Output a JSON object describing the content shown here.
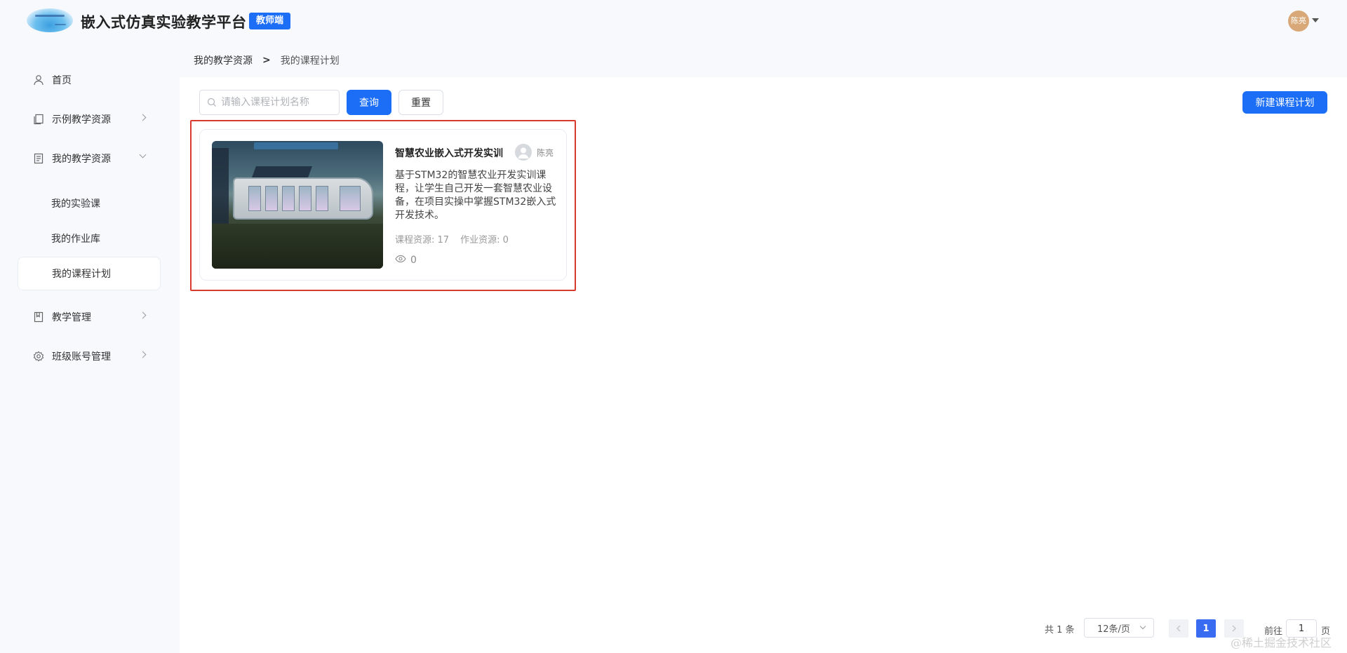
{
  "header": {
    "app_title": "嵌入式仿真实验教学平台",
    "role_badge": "教师端",
    "user_name": "陈亮"
  },
  "sidebar": {
    "items": [
      {
        "label": "首页",
        "icon": "user-icon"
      },
      {
        "label": "示例教学资源",
        "icon": "book-copy-icon"
      },
      {
        "label": "我的教学资源",
        "icon": "document-icon"
      },
      {
        "label": "教学管理",
        "icon": "bookmark-book-icon"
      },
      {
        "label": "班级账号管理",
        "icon": "gear-icon"
      }
    ],
    "sub_items": [
      {
        "label": "我的实验课"
      },
      {
        "label": "我的作业库"
      },
      {
        "label": "我的课程计划"
      }
    ]
  },
  "breadcrumb": {
    "parent": "我的教学资源",
    "separator": ">",
    "current": "我的课程计划"
  },
  "toolbar": {
    "search_placeholder": "请输入课程计划名称",
    "search_value": "",
    "query_label": "查询",
    "reset_label": "重置",
    "new_plan_label": "新建课程计划"
  },
  "cards": [
    {
      "title": "智慧农业嵌入式开发实训",
      "author": "陈亮",
      "description": "基于STM32的智慧农业开发实训课程，让学生自己开发一套智慧农业设备，在项目实操中掌握STM32嵌入式开发技术。",
      "course_resources": "课程资源: 17",
      "homework_resources": "作业资源: 0",
      "views": "0"
    }
  ],
  "pagination": {
    "total": "共 1 条",
    "page_size": "12条/页",
    "current_page": "1",
    "goto_label": "前往",
    "goto_value": "1",
    "page_suffix": "页"
  },
  "watermark": "@稀土掘金技术社区",
  "colors": {
    "primary": "#1b6ef5",
    "highlight": "#d93a2f",
    "page_active": "#3a6cf1"
  }
}
